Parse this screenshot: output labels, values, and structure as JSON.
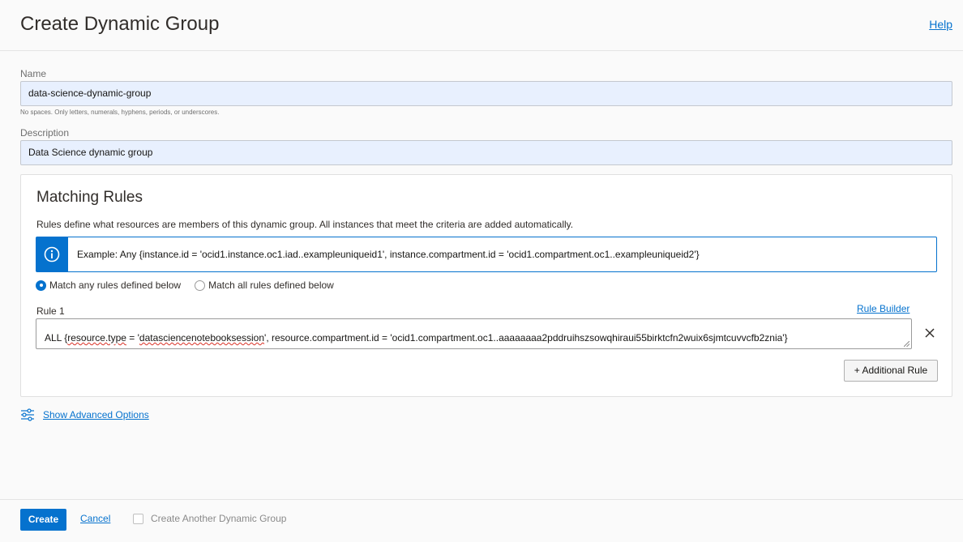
{
  "header": {
    "title": "Create Dynamic Group",
    "help_label": "Help"
  },
  "form": {
    "name_label": "Name",
    "name_value": "data-science-dynamic-group",
    "name_hint": "No spaces. Only letters, numerals, hyphens, periods, or underscores.",
    "description_label": "Description",
    "description_value": "Data Science dynamic group"
  },
  "matching_rules": {
    "title": "Matching Rules",
    "description": "Rules define what resources are members of this dynamic group. All instances that meet the criteria are added automatically.",
    "example_text": "Example: Any {instance.id = 'ocid1.instance.oc1.iad..exampleuniqueid1', instance.compartment.id = 'ocid1.compartment.oc1..exampleuniqueid2'}",
    "match_options": [
      {
        "label": "Match any rules defined below",
        "selected": true
      },
      {
        "label": "Match all rules defined below",
        "selected": false
      }
    ],
    "rule1": {
      "label": "Rule 1",
      "builder_label": "Rule Builder",
      "value_prefix": "ALL {",
      "value_token1": "resource.type",
      "value_mid1": " = '",
      "value_token2": "datasciencenotebooksession",
      "value_suffix": "', resource.compartment.id = 'ocid1.compartment.oc1..aaaaaaaa2pddruihszsowqhiraui55birktcfn2wuix6sjmtcuvvcfb2znia'}"
    },
    "additional_rule_label": "+ Additional Rule"
  },
  "advanced": {
    "label": "Show Advanced Options"
  },
  "footer": {
    "create_label": "Create",
    "cancel_label": "Cancel",
    "create_another_label": "Create Another Dynamic Group",
    "create_another_checked": false
  },
  "colors": {
    "accent": "#0572ce",
    "input_fill": "#e8f0fe"
  }
}
